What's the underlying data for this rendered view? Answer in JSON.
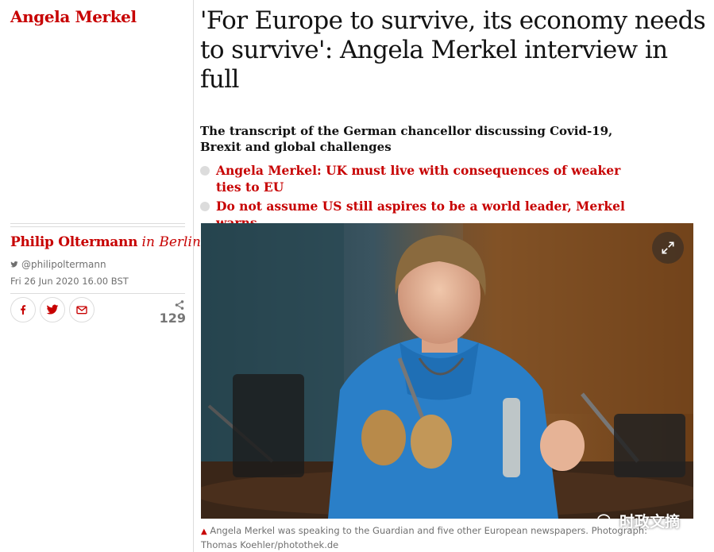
{
  "section": {
    "label": "Angela Merkel"
  },
  "article": {
    "headline": "'For Europe to survive, its economy needs to survive': Angela Merkel interview in full",
    "standfirst": "The transcript of the German chancellor discussing Covid-19, Brexit and global challenges",
    "related": [
      {
        "label": "Angela Merkel: UK must live with consequences of weaker ties to EU"
      },
      {
        "label": "Do not assume US still aspires to be a world leader, Merkel warns"
      }
    ]
  },
  "byline": {
    "author": "Philip Oltermann",
    "location": "in Berlin",
    "twitter": "@philipoltermann",
    "date": "Fri 26 Jun 2020 16.00 BST"
  },
  "share": {
    "icons": [
      "facebook-icon",
      "twitter-icon",
      "email-icon"
    ],
    "count": "129"
  },
  "image": {
    "caption": "Angela Merkel was speaking to the Guardian and five other European newspapers. Photograph: Thomas Koehler/photothek.de"
  },
  "watermark": {
    "text": "时政文摘"
  },
  "colors": {
    "accent": "#c70000",
    "text": "#121212",
    "muted": "#707070",
    "rule": "#dcdcdc"
  }
}
